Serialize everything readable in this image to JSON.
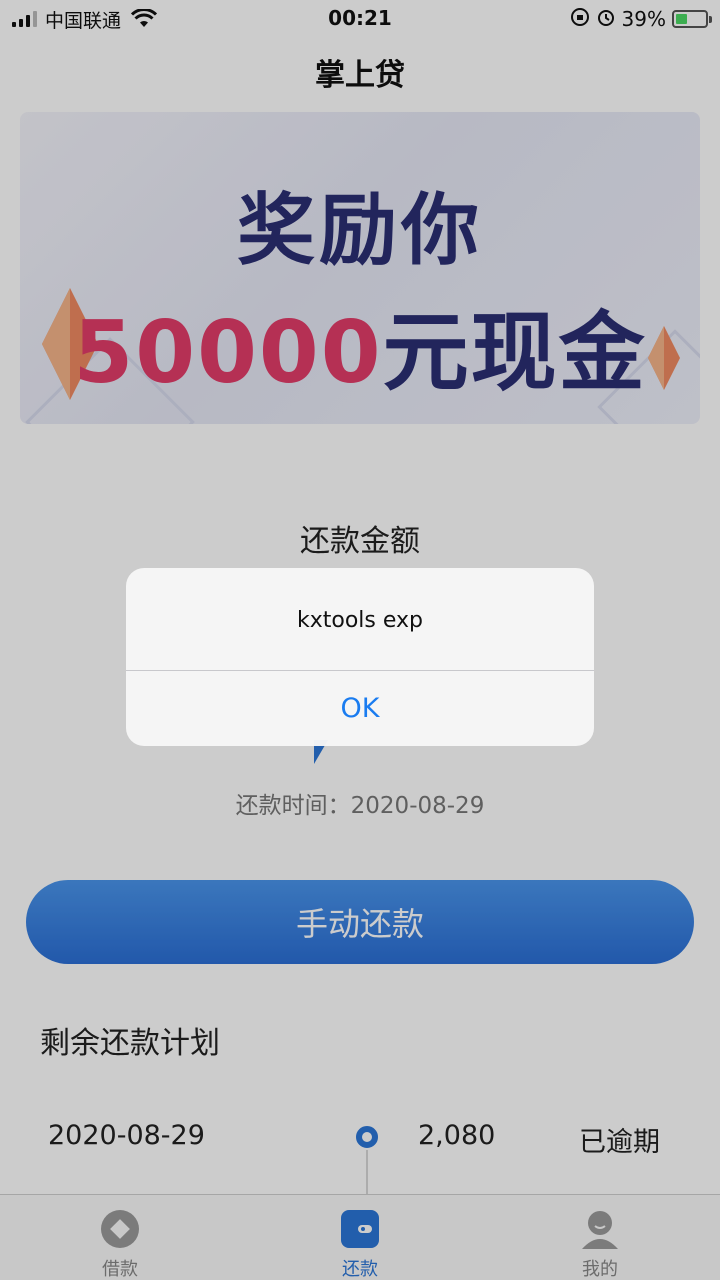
{
  "status_bar": {
    "carrier": "中国联通",
    "time": "00:21",
    "battery_percent": "39%",
    "battery_level": 0.39
  },
  "nav": {
    "title": "掌上贷"
  },
  "banner": {
    "line1": "奖励你",
    "amount": "50000",
    "unit": "元现金",
    "colors": {
      "primary": "#2b2f74",
      "accent": "#e33d6a"
    }
  },
  "repay": {
    "amount_label": "还款金额",
    "time_label": "还款时间：",
    "time_value": "2020-08-29",
    "button_label": "手动还款"
  },
  "plan": {
    "title": "剩余还款计划",
    "rows": [
      {
        "date": "2020-08-29",
        "amount": "2,080",
        "status": "已逾期"
      }
    ]
  },
  "tabs": [
    {
      "label": "借款",
      "icon": "loan-icon",
      "active": false
    },
    {
      "label": "还款",
      "icon": "wallet-icon",
      "active": true
    },
    {
      "label": "我的",
      "icon": "profile-icon",
      "active": false
    }
  ],
  "alert": {
    "message": "kxtools exp",
    "ok_label": "OK"
  },
  "colors": {
    "accent": "#2b76d8",
    "link": "#1a7cf0"
  }
}
